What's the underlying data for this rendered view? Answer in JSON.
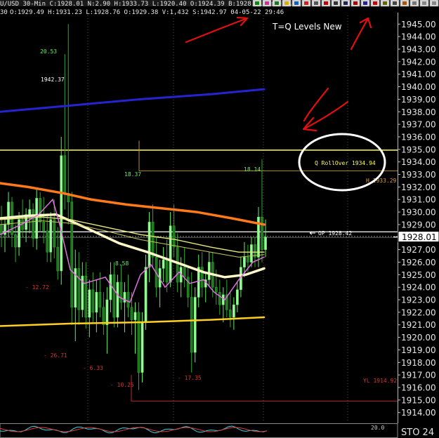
{
  "header": {
    "symbol_interval": "U/USD  30-Min",
    "quote": "C:1928.01  N:2.90  H:1933.73  L:1920.40  O:1924.39  B:1928.01  A:1928.44",
    "titlebar_info": "O:1929.49  H:1931.23  L:1928.76  O:1929.38  V:1,432  S:1942.97  04-05-22  29:46",
    "left_edge_text": "30"
  },
  "annotation": {
    "title": "T=Q Levels New",
    "arrow_color": "#e01010",
    "circle_color": "#ffffff"
  },
  "price_axis": {
    "ticks": [
      "1945.00",
      "1944.00",
      "1943.00",
      "1942.00",
      "1941.00",
      "1940.00",
      "1939.00",
      "1938.00",
      "1937.00",
      "1936.00",
      "1935.00",
      "1934.00",
      "1933.00",
      "1932.00",
      "1931.00",
      "1930.00",
      "1929.00",
      "1928.00",
      "1927.00",
      "1926.00",
      "1925.00",
      "1924.00",
      "1923.00",
      "1922.00",
      "1921.00",
      "1920.00",
      "1919.00",
      "1918.00",
      "1917.00",
      "1916.00",
      "1915.00",
      "1914.00"
    ],
    "last_price": "1928.01"
  },
  "levels": {
    "q_rollover": "Q RollOver 1934.94",
    "h_level": "H 1933.29",
    "op_level": "OP 1928.42",
    "yl_level": "YL 1914.92"
  },
  "value_labels": {
    "peak_left": "20.53",
    "price_left": "1942.37",
    "mid_high": "18.37",
    "right_high": "18.14",
    "mid_val": "8.58",
    "neg1": "- 12.72",
    "neg2": "- 26.71",
    "neg3": "- 6.33",
    "neg4": "- 10.25",
    "neg5": "- 17.35"
  },
  "indicator": {
    "label": "STO 24",
    "mini_label": "20.0"
  },
  "chart_data": {
    "type": "candlestick",
    "title": "",
    "ylabel": "",
    "ylim": [
      1913.2,
      1945.8
    ],
    "levels": [
      {
        "name": "Q RollOver",
        "value": 1934.94,
        "color": "#ffff55"
      },
      {
        "name": "H",
        "value": 1933.29,
        "color": "#d89a2a"
      },
      {
        "name": "OP",
        "value": 1928.42,
        "color": "#ffffff"
      },
      {
        "name": "YL",
        "value": 1914.92,
        "color": "#cc3030"
      }
    ],
    "series": [
      {
        "color": "#2020c8",
        "y_start": 1938.0,
        "y_end": 1939.8
      },
      {
        "color": "#ffd020",
        "y_start": 1920.9,
        "y_end": 1921.6
      },
      {
        "color": "#ff7a1a",
        "y_start": 1932.3,
        "y_end": 1929.0
      },
      {
        "color": "#ffffc8",
        "y_start": 1929.5,
        "y_end": 1925.5
      },
      {
        "color": "#e8e890",
        "y_start": 1929.4,
        "y_end": 1926.8
      },
      {
        "color": "#e070e0",
        "y_start": 1927.5,
        "y_end": 1926.4
      }
    ],
    "candles": [
      [
        1929,
        1930.5,
        1927.2,
        1928.2
      ],
      [
        1928.2,
        1929.5,
        1926.8,
        1929.0
      ],
      [
        1929.0,
        1931.6,
        1928.0,
        1930.8
      ],
      [
        1930.8,
        1931.2,
        1927.2,
        1928.2
      ],
      [
        1928.2,
        1929.0,
        1926.0,
        1927.2
      ],
      [
        1927.2,
        1930.0,
        1926.5,
        1929.4
      ],
      [
        1929.4,
        1931.0,
        1928.0,
        1928.6
      ],
      [
        1928.6,
        1930.3,
        1927.6,
        1929.8
      ],
      [
        1929.8,
        1931.0,
        1928.3,
        1930.2
      ],
      [
        1930.2,
        1930.7,
        1927.2,
        1927.9
      ],
      [
        1927.9,
        1931.9,
        1927.0,
        1931.1
      ],
      [
        1931.1,
        1931.6,
        1928.4,
        1929.2
      ],
      [
        1929.2,
        1931.2,
        1927.5,
        1928.5
      ],
      [
        1928.5,
        1929.9,
        1926.0,
        1926.8
      ],
      [
        1926.8,
        1930.0,
        1926.0,
        1929.4
      ],
      [
        1929.4,
        1931.0,
        1926.3,
        1927.2
      ],
      [
        1927.2,
        1928.8,
        1924.6,
        1925.3
      ],
      [
        1925.3,
        1936.0,
        1924.2,
        1934.5
      ],
      [
        1934.5,
        1942.6,
        1930.2,
        1931.5
      ],
      [
        1931.5,
        1945.0,
        1929.0,
        1930.8
      ],
      [
        1930.8,
        1931.6,
        1921.0,
        1922.4
      ],
      [
        1922.4,
        1927.0,
        1919.7,
        1925.5
      ],
      [
        1925.5,
        1926.8,
        1921.0,
        1922.2
      ],
      [
        1922.2,
        1926.0,
        1921.6,
        1924.9
      ],
      [
        1924.9,
        1926.0,
        1920.7,
        1921.6
      ],
      [
        1921.6,
        1924.6,
        1920.0,
        1923.8
      ],
      [
        1923.8,
        1925.2,
        1921.2,
        1922.0
      ],
      [
        1922.0,
        1924.6,
        1920.4,
        1923.6
      ],
      [
        1923.6,
        1925.2,
        1921.6,
        1922.4
      ],
      [
        1922.4,
        1923.6,
        1920.2,
        1921.0
      ],
      [
        1921.0,
        1924.0,
        1918.7,
        1923.0
      ],
      [
        1923.0,
        1926.0,
        1922.0,
        1925.0
      ],
      [
        1925.0,
        1926.0,
        1920.8,
        1921.6
      ],
      [
        1921.6,
        1925.0,
        1920.8,
        1924.4
      ],
      [
        1924.4,
        1925.8,
        1922.2,
        1922.8
      ],
      [
        1922.8,
        1924.4,
        1920.4,
        1923.6
      ],
      [
        1923.6,
        1925.0,
        1921.6,
        1922.4
      ],
      [
        1922.4,
        1923.6,
        1920.2,
        1921.4
      ],
      [
        1921.4,
        1922.8,
        1918.7,
        1922.0
      ],
      [
        1922.0,
        1922.8,
        1915.8,
        1917.2
      ],
      [
        1917.2,
        1922.0,
        1916.4,
        1921.2
      ],
      [
        1921.2,
        1926.6,
        1920.6,
        1925.6
      ],
      [
        1925.6,
        1930.0,
        1924.4,
        1929.2
      ],
      [
        1929.2,
        1930.6,
        1925.6,
        1926.4
      ],
      [
        1926.4,
        1928.0,
        1923.2,
        1924.0
      ],
      [
        1924.0,
        1926.2,
        1922.4,
        1925.5
      ],
      [
        1925.5,
        1927.2,
        1924.4,
        1926.2
      ],
      [
        1926.2,
        1927.8,
        1923.6,
        1924.4
      ],
      [
        1924.4,
        1930.0,
        1924.0,
        1928.9
      ],
      [
        1928.9,
        1930.6,
        1926.4,
        1927.2
      ],
      [
        1927.2,
        1928.3,
        1923.6,
        1924.4
      ],
      [
        1924.4,
        1926.4,
        1923.2,
        1925.6
      ],
      [
        1925.6,
        1927.2,
        1924.0,
        1924.8
      ],
      [
        1924.8,
        1925.6,
        1922.4,
        1923.2
      ],
      [
        1923.2,
        1925.2,
        1917.2,
        1918.8
      ],
      [
        1918.8,
        1924.0,
        1918.0,
        1923.2
      ],
      [
        1923.2,
        1926.6,
        1922.4,
        1925.6
      ],
      [
        1925.6,
        1926.8,
        1923.2,
        1924.0
      ],
      [
        1924.0,
        1925.2,
        1922.8,
        1924.6
      ],
      [
        1924.6,
        1926.8,
        1924.0,
        1926.0
      ],
      [
        1926.0,
        1926.8,
        1923.2,
        1924.0
      ],
      [
        1924.0,
        1925.4,
        1922.6,
        1923.6
      ],
      [
        1923.6,
        1924.6,
        1921.8,
        1922.6
      ],
      [
        1922.6,
        1924.0,
        1921.2,
        1923.4
      ],
      [
        1923.4,
        1924.6,
        1921.6,
        1922.2
      ],
      [
        1922.2,
        1923.6,
        1920.8,
        1921.6
      ],
      [
        1921.6,
        1923.2,
        1920.6,
        1922.6
      ],
      [
        1922.6,
        1924.4,
        1922.0,
        1923.8
      ],
      [
        1923.8,
        1926.4,
        1923.2,
        1925.6
      ],
      [
        1925.6,
        1927.6,
        1924.8,
        1926.4
      ],
      [
        1926.4,
        1927.4,
        1925.2,
        1926.0
      ],
      [
        1926.0,
        1928.0,
        1925.6,
        1927.4
      ],
      [
        1927.4,
        1928.0,
        1925.6,
        1926.4
      ],
      [
        1926.4,
        1930.4,
        1925.6,
        1929.6
      ],
      [
        1929.6,
        1934.2,
        1926.0,
        1927.0
      ],
      [
        1927.0,
        1929.4,
        1926.4,
        1928.0
      ]
    ]
  }
}
